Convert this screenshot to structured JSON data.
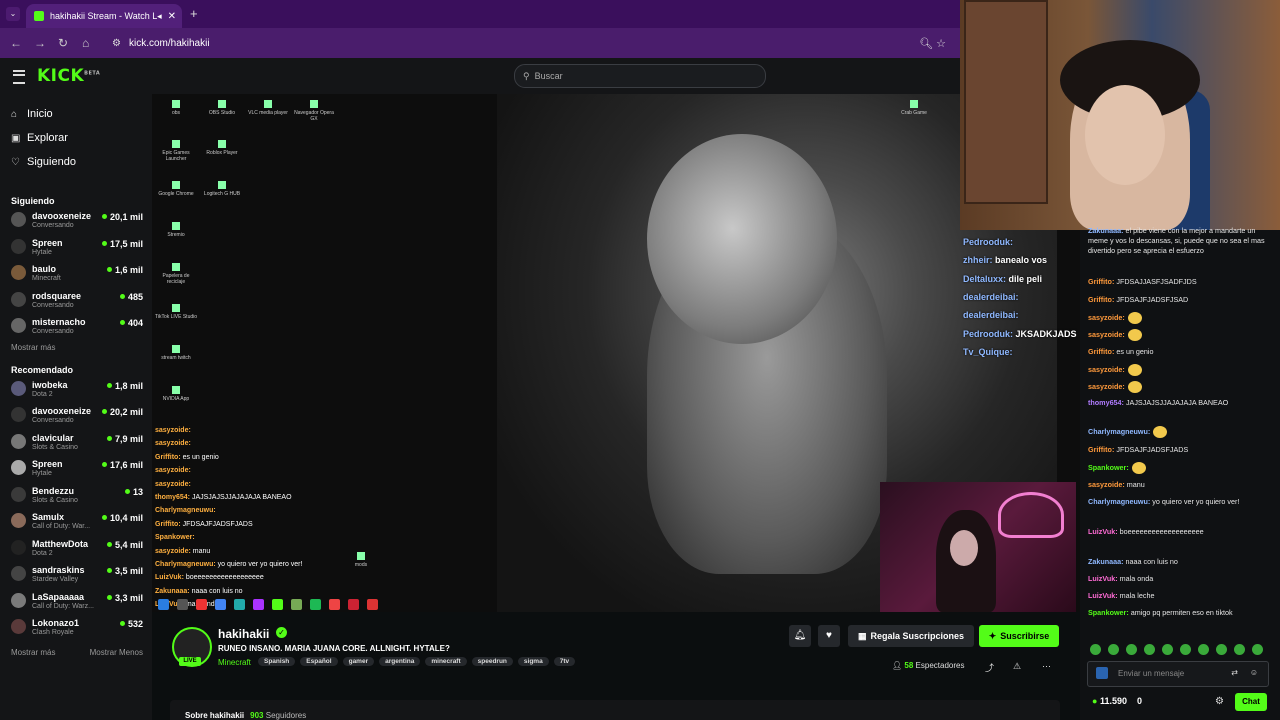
{
  "browser": {
    "tab_title": "hakihakii Stream - Watch L",
    "url": "kick.com/hakihakii"
  },
  "header": {
    "logo": "KICK",
    "logo_badge": "BETA",
    "search_placeholder": "Buscar"
  },
  "sidebar": {
    "nav": [
      {
        "label": "Inicio",
        "icon": "home-icon"
      },
      {
        "label": "Explorar",
        "icon": "compass-icon"
      },
      {
        "label": "Siguiendo",
        "icon": "heart-icon"
      }
    ],
    "following_title": "Siguiendo",
    "following": [
      {
        "name": "davooxeneize",
        "game": "Conversando",
        "viewers": "20,1 mil"
      },
      {
        "name": "Spreen",
        "game": "Hytale",
        "viewers": "17,5 mil"
      },
      {
        "name": "baulo",
        "game": "Minecraft",
        "viewers": "1,6 mil"
      },
      {
        "name": "rodsquaree",
        "game": "Conversando",
        "viewers": "485"
      },
      {
        "name": "misternacho",
        "game": "Conversando",
        "viewers": "404"
      }
    ],
    "show_more": "Mostrar más",
    "recommended_title": "Recomendado",
    "recommended": [
      {
        "name": "iwobeka",
        "game": "Dota 2",
        "viewers": "1,8 mil"
      },
      {
        "name": "davooxeneize",
        "game": "Conversando",
        "viewers": "20,2 mil"
      },
      {
        "name": "clavicular",
        "game": "Slots & Casino",
        "viewers": "7,9 mil"
      },
      {
        "name": "Spreen",
        "game": "Hytale",
        "viewers": "17,6 mil"
      },
      {
        "name": "Bendezzu",
        "game": "Slots & Casino",
        "viewers": "13"
      },
      {
        "name": "Samulx",
        "game": "Call of Duty: War...",
        "viewers": "10,4 mil"
      },
      {
        "name": "MatthewDota",
        "game": "Dota 2",
        "viewers": "5,4 mil"
      },
      {
        "name": "sandraskins",
        "game": "Stardew Valley",
        "viewers": "3,5 mil"
      },
      {
        "name": "LaSapaaaaa",
        "game": "Call of Duty: Warz...",
        "viewers": "3,3 mil"
      },
      {
        "name": "Lokonazo1",
        "game": "Clash Royale",
        "viewers": "532"
      }
    ],
    "show_more_bottom": "Mostrar más",
    "show_less": "Mostrar Menos"
  },
  "desktop_icons": [
    "obs",
    "OBS Studio",
    "VLC media player",
    "Navegador Opera GX",
    "Epic Games Launcher",
    "Roblox Player",
    "Google Chrome",
    "Logitech G HUB",
    "Stremio",
    "Papelera de reciclaje",
    "TikTok LIVE Studio",
    "stream twitch",
    "NVIDIA App",
    "Crab Game",
    "mods"
  ],
  "overlay_chat_left": [
    {
      "user": "sasyzoide:",
      "text": ""
    },
    {
      "user": "sasyzoide:",
      "text": ""
    },
    {
      "user": "Griffito:",
      "text": "es un genio"
    },
    {
      "user": "sasyzoide:",
      "text": ""
    },
    {
      "user": "sasyzoide:",
      "text": ""
    },
    {
      "user": "thomy654:",
      "text": "JAJSJAJSJJAJAJAJA BANEAO"
    },
    {
      "user": "Charlymagneuwu:",
      "text": ""
    },
    {
      "user": "Griffito:",
      "text": "JFDSAJFJADSFJADS"
    },
    {
      "user": "Spankower:",
      "text": ""
    },
    {
      "user": "sasyzoide:",
      "text": "manu"
    },
    {
      "user": "Charlymagneuwu:",
      "text": "yo quiero ver yo quiero ver!"
    },
    {
      "user": "LuizVuk:",
      "text": "boeeeeeeeeeeeeeeeeee"
    },
    {
      "user": "Zakunaaa:",
      "text": "naaa con luis no"
    },
    {
      "user": "LuizVuk:",
      "text": "mala onda"
    }
  ],
  "overlay_chat_right": [
    {
      "user": "Pedrooduk:",
      "text": ""
    },
    {
      "user": "zhheir:",
      "text": "banealo vos"
    },
    {
      "user": "Deltaluxx:",
      "text": "dile peli"
    },
    {
      "user": "dealerdeibai:",
      "text": ""
    },
    {
      "user": "dealerdeibai:",
      "text": ""
    },
    {
      "user": "Pedrooduk:",
      "text": "JKSADKJADS"
    },
    {
      "user": "Tv_Quique:",
      "text": ""
    }
  ],
  "stream": {
    "name": "hakihakii",
    "live": "LIVE",
    "title": "RUNEO INSANO. MARIA JUANA CORE. ALLNIGHT. HYTALE?",
    "category": "Minecraft",
    "tags": [
      "Spanish",
      "Español",
      "gamer",
      "argentina",
      "minecraft",
      "speedrun",
      "sigma",
      "7tv"
    ],
    "gift_label": "Regala Suscripciones",
    "subscribe_label": "Suscribirse",
    "viewers": "58",
    "viewers_label": "Espectadores",
    "about_label": "Sobre hakihakii",
    "followers": "903",
    "followers_label": "Seguidores"
  },
  "chat": {
    "messages": [
      {
        "user": "Zakunaaa:",
        "text": "el pibe viene con la mejor a mandarte un meme y vos lo descansas, si, puede que no sea el mas divertido pero se aprecia el esfuerzo",
        "color": "#8fb8ff"
      },
      {
        "user": "Griffito:",
        "text": "JFDSAJJASFJSADFJDS",
        "color": "#ff9a3c"
      },
      {
        "user": "Griffito:",
        "text": "JFDSAJFJADSFJSAD",
        "color": "#ff9a3c"
      },
      {
        "user": "sasyzoide:",
        "text": "",
        "color": "#ff9a3c"
      },
      {
        "user": "sasyzoide:",
        "text": "",
        "color": "#ff9a3c"
      },
      {
        "user": "Griffito:",
        "text": "es un genio",
        "color": "#ff9a3c"
      },
      {
        "user": "sasyzoide:",
        "text": "",
        "color": "#ff9a3c"
      },
      {
        "user": "sasyzoide:",
        "text": "",
        "color": "#ff9a3c"
      },
      {
        "user": "thomy654:",
        "text": "JAJSJAJSJJAJAJAJA BANEAO",
        "color": "#b07cff"
      },
      {
        "user": "Charlymagneuwu:",
        "text": "",
        "color": "#8fb8ff"
      },
      {
        "user": "Griffito:",
        "text": "JFDSAJFJADSFJADS",
        "color": "#ff9a3c"
      },
      {
        "user": "Spankower:",
        "text": "",
        "color": "#53fc18"
      },
      {
        "user": "sasyzoide:",
        "text": "manu",
        "color": "#ff9a3c"
      },
      {
        "user": "Charlymagneuwu:",
        "text": "yo quiero ver yo quiero ver!",
        "color": "#8fb8ff"
      },
      {
        "user": "LuizVuk:",
        "text": "boeeeeeeeeeeeeeeeeeee",
        "color": "#ff6bd5"
      },
      {
        "user": "Zakunaaa:",
        "text": "naaa con luis no",
        "color": "#8fb8ff"
      },
      {
        "user": "LuizVuk:",
        "text": "mala onda",
        "color": "#ff6bd5"
      },
      {
        "user": "LuizVuk:",
        "text": "mala leche",
        "color": "#ff6bd5"
      },
      {
        "user": "Spankower:",
        "text": "amigo pq permiten eso en tiktok",
        "color": "#53fc18"
      }
    ],
    "input_placeholder": "Enviar un mensaje",
    "points": "11.590",
    "points_right": "0",
    "chat_button": "Chat"
  }
}
